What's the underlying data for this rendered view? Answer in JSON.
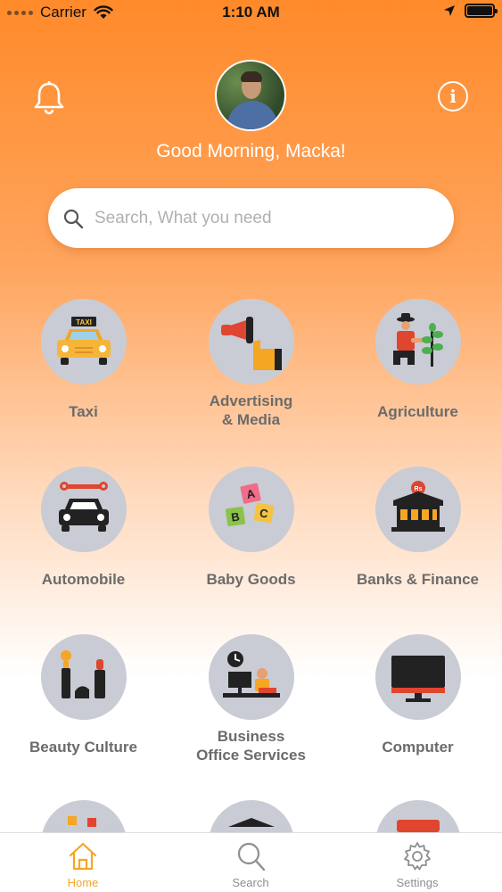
{
  "status_bar": {
    "carrier": "Carrier",
    "time": "1:10 AM"
  },
  "header": {
    "greeting": "Good Morning, Macka!",
    "bell_icon": "bell-icon",
    "info_icon": "info-icon",
    "info_glyph": "i"
  },
  "search": {
    "placeholder": "Search, What you need",
    "value": ""
  },
  "categories": [
    {
      "label": "Taxi",
      "icon": "taxi-icon"
    },
    {
      "label": "Advertising\n& Media",
      "icon": "megaphone-icon"
    },
    {
      "label": "Agriculture",
      "icon": "farmer-icon"
    },
    {
      "label": "Automobile",
      "icon": "car-repair-icon"
    },
    {
      "label": "Baby Goods",
      "icon": "abc-blocks-icon"
    },
    {
      "label": "Banks & Finance",
      "icon": "bank-icon"
    },
    {
      "label": "Beauty Culture",
      "icon": "cosmetics-icon"
    },
    {
      "label": "Business\nOffice Services",
      "icon": "office-desk-icon"
    },
    {
      "label": "Computer",
      "icon": "monitor-icon"
    }
  ],
  "tab_bar": {
    "tabs": [
      {
        "label": "Home",
        "icon": "home-icon",
        "active": true
      },
      {
        "label": "Search",
        "icon": "search-icon",
        "active": false
      },
      {
        "label": "Settings",
        "icon": "gear-icon",
        "active": false
      }
    ]
  },
  "colors": {
    "accent": "#f5a623",
    "header_orange": "#ff8a2a",
    "category_circle": "#c9ccd4",
    "label_gray": "#6b6b6b"
  }
}
